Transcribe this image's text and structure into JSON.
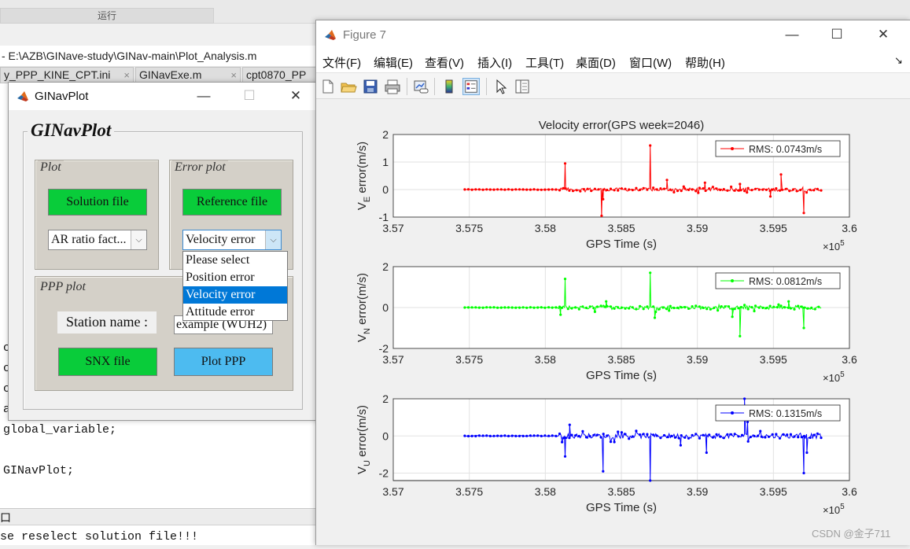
{
  "ide": {
    "run_tab": "运行",
    "editor_title": "- E:\\AZB\\GINave-study\\GINav-main\\Plot_Analysis.m",
    "tabs": [
      {
        "label": "y_PPP_KINE_CPT.ini",
        "close": "×"
      },
      {
        "label": "GINavExe.m",
        "close": "×"
      },
      {
        "label": "cpt0870_PP"
      }
    ],
    "code_lines": [
      "global_variable;",
      "GINavPlot;"
    ],
    "code_fragments": [
      "c",
      "c",
      "c",
      "a"
    ],
    "cmd_header_char": "口",
    "cmd_output": "se reselect solution file!!!"
  },
  "gui": {
    "window_title": "GINavPlot",
    "controls": {
      "min": "—",
      "max": "☐",
      "close": "✕"
    },
    "main_title": "GINavPlot",
    "plot_panel": {
      "title": "Plot",
      "solution_button": "Solution file",
      "select_value": "AR ratio fact..."
    },
    "error_panel": {
      "title": "Error plot",
      "reference_button": "Reference file",
      "select_value": "Velocity error",
      "options": [
        "Please select",
        "Position error",
        "Velocity error",
        "Attitude error"
      ],
      "selected_index": 2
    },
    "ppp_panel": {
      "title": "PPP plot",
      "station_label": "Station name :",
      "station_value": "example (WUH2)",
      "snx_button": "SNX file",
      "plot_button": "Plot PPP"
    }
  },
  "figure": {
    "window_title": "Figure 7",
    "controls": {
      "min": "—",
      "max": "☐",
      "close": "✕"
    },
    "menu": [
      "文件(F)",
      "编辑(E)",
      "查看(V)",
      "插入(I)",
      "工具(T)",
      "桌面(D)",
      "窗口(W)",
      "帮助(H)"
    ],
    "menu_arrow": "↘",
    "toolbar": [
      "new-figure",
      "open-file",
      "save",
      "print",
      "link-plot",
      "colorbar",
      "legend",
      "pointer",
      "property-inspector"
    ],
    "watermark": "CSDN @金子711"
  },
  "colors": {
    "east": "#ff0000",
    "north": "#00ff00",
    "up": "#0000ff",
    "button_green": "#09cc3a",
    "button_blue": "#4dbbf0",
    "panel_gray": "#d4d0c8",
    "select_highlight": "#0078d7"
  },
  "chart_data": [
    {
      "type": "line",
      "title": "Velocity error(GPS week=2046)",
      "xlabel": "GPS Time (s)",
      "ylabel": "V_E error(m/s)",
      "xlim": [
        357000,
        360000
      ],
      "ylim": [
        -1,
        2
      ],
      "xticks": [
        "3.57",
        "3.575",
        "3.58",
        "3.585",
        "3.59",
        "3.595",
        "3.6"
      ],
      "xexponent": "×10^5",
      "yticks": [
        "-1",
        "0",
        "1",
        "2"
      ],
      "legend": "RMS: 0.0743m/s",
      "legend_position": "top-right",
      "grid": true,
      "series": [
        {
          "color": "#ff0000",
          "x_range": [
            357470,
            359820
          ],
          "dense_from": 358080,
          "noise": 0.06,
          "spikes": [
            [
              358130,
              0.95
            ],
            [
              358370,
              -0.95
            ],
            [
              358380,
              -0.35
            ],
            [
              358690,
              1.6
            ],
            [
              358800,
              0.35
            ],
            [
              359050,
              0.25
            ],
            [
              359280,
              0.2
            ],
            [
              359550,
              0.55
            ],
            [
              359700,
              -0.85
            ],
            [
              359480,
              -0.25
            ]
          ]
        }
      ]
    },
    {
      "type": "line",
      "title": "",
      "xlabel": "GPS Time (s)",
      "ylabel": "V_N error(m/s)",
      "xlim": [
        357000,
        360000
      ],
      "ylim": [
        -2,
        2
      ],
      "xticks": [
        "3.57",
        "3.575",
        "3.58",
        "3.585",
        "3.59",
        "3.595",
        "3.6"
      ],
      "xexponent": "×10^5",
      "yticks": [
        "-2",
        "0",
        "2"
      ],
      "legend": "RMS: 0.0812m/s",
      "legend_position": "top-right",
      "grid": true,
      "series": [
        {
          "color": "#00ff00",
          "x_range": [
            357470,
            359820
          ],
          "dense_from": 358080,
          "noise": 0.09,
          "spikes": [
            [
              358130,
              1.4
            ],
            [
              358100,
              -0.35
            ],
            [
              358690,
              1.7
            ],
            [
              358720,
              -0.5
            ],
            [
              359280,
              -1.4
            ],
            [
              359230,
              -0.45
            ],
            [
              359700,
              -1.0
            ],
            [
              359600,
              0.3
            ],
            [
              358400,
              0.3
            ]
          ]
        }
      ]
    },
    {
      "type": "line",
      "title": "",
      "xlabel": "GPS Time (s)",
      "ylabel": "V_U error(m/s)",
      "xlim": [
        357000,
        360000
      ],
      "ylim": [
        -2.4,
        2
      ],
      "xticks": [
        "3.57",
        "3.575",
        "3.58",
        "3.585",
        "3.59",
        "3.595",
        "3.6"
      ],
      "xexponent": "×10^5",
      "yticks": [
        "-2",
        "0",
        "2"
      ],
      "legend": "RMS: 0.1315m/s",
      "legend_position": "top-right",
      "grid": true,
      "series": [
        {
          "color": "#0000ff",
          "x_range": [
            357470,
            359820
          ],
          "dense_from": 358080,
          "noise": 0.13,
          "spikes": [
            [
              358130,
              -1.1
            ],
            [
              358380,
              -1.9
            ],
            [
              358690,
              -2.4
            ],
            [
              359310,
              2.0
            ],
            [
              359330,
              0.75
            ],
            [
              359700,
              -2.0
            ],
            [
              359720,
              -0.9
            ],
            [
              359060,
              -0.9
            ],
            [
              358890,
              -0.5
            ],
            [
              358160,
              0.6
            ]
          ]
        }
      ]
    }
  ]
}
